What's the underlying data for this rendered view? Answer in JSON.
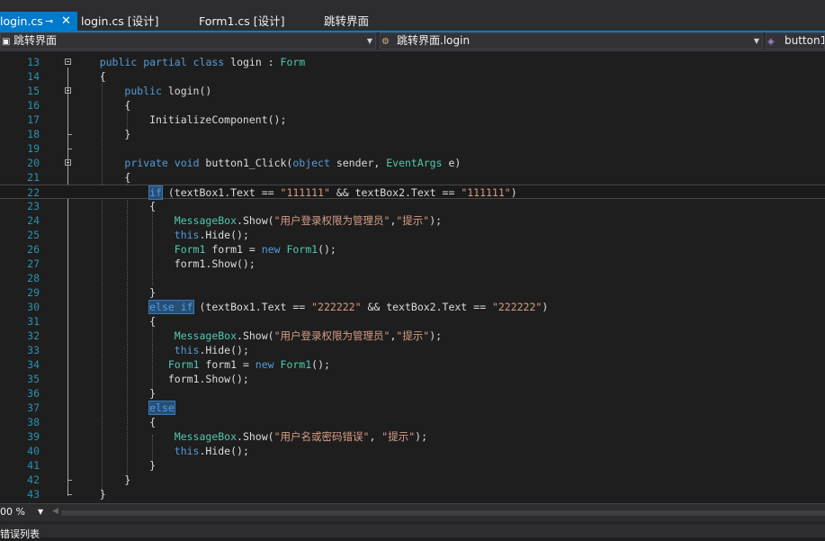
{
  "tabs": [
    {
      "label": "login.cs",
      "active": true,
      "pin": "⊸",
      "close": "✕"
    },
    {
      "label": "login.cs [设计]"
    },
    {
      "label": "Form1.cs [设计]"
    },
    {
      "label": "跳转界面"
    }
  ],
  "navbar": {
    "project": "跳转界面",
    "class": "跳转界面.login",
    "member": "button1"
  },
  "editor": {
    "lines": [
      {
        "n": "13",
        "code": "    public partial class login : Form"
      },
      {
        "n": "14",
        "code": "    {"
      },
      {
        "n": "15",
        "code": "        public login()"
      },
      {
        "n": "16",
        "code": "        {"
      },
      {
        "n": "17",
        "code": "            InitializeComponent();"
      },
      {
        "n": "18",
        "code": "        }"
      },
      {
        "n": "19",
        "code": ""
      },
      {
        "n": "20",
        "code": "        private void button1_Click(object sender, EventArgs e)"
      },
      {
        "n": "21",
        "code": "        {"
      },
      {
        "n": "22",
        "code": "            if (textBox1.Text == \"111111\" && textBox2.Text == \"111111\")"
      },
      {
        "n": "23",
        "code": "            {"
      },
      {
        "n": "24",
        "code": "                MessageBox.Show(\"用户登录权限为管理员\",\"提示\");"
      },
      {
        "n": "25",
        "code": "                this.Hide();"
      },
      {
        "n": "26",
        "code": "                Form1 form1 = new Form1();"
      },
      {
        "n": "27",
        "code": "                form1.Show();"
      },
      {
        "n": "28",
        "code": ""
      },
      {
        "n": "29",
        "code": "            }"
      },
      {
        "n": "30",
        "code": "            else if (textBox1.Text == \"222222\" && textBox2.Text == \"222222\")"
      },
      {
        "n": "31",
        "code": "            {"
      },
      {
        "n": "32",
        "code": "                MessageBox.Show(\"用户登录权限为管理员\",\"提示\");"
      },
      {
        "n": "33",
        "code": "                this.Hide();"
      },
      {
        "n": "34",
        "code": "               Form1 form1 = new Form1();"
      },
      {
        "n": "35",
        "code": "               form1.Show();"
      },
      {
        "n": "36",
        "code": "            }"
      },
      {
        "n": "37",
        "code": "            else"
      },
      {
        "n": "38",
        "code": "            {"
      },
      {
        "n": "39",
        "code": "                MessageBox.Show(\"用户名或密码错误\", \"提示\");"
      },
      {
        "n": "40",
        "code": "                this.Hide();"
      },
      {
        "n": "41",
        "code": "            }"
      },
      {
        "n": "42",
        "code": "        }"
      },
      {
        "n": "43",
        "code": "    }"
      }
    ]
  },
  "bottom": {
    "zoom": "00 %",
    "error_list": "错误列表"
  },
  "colors": {
    "keyword": "#569cd6",
    "type": "#4ec9b0",
    "string": "#d69d85",
    "line_number": "#2b91af",
    "accent": "#007acc"
  }
}
